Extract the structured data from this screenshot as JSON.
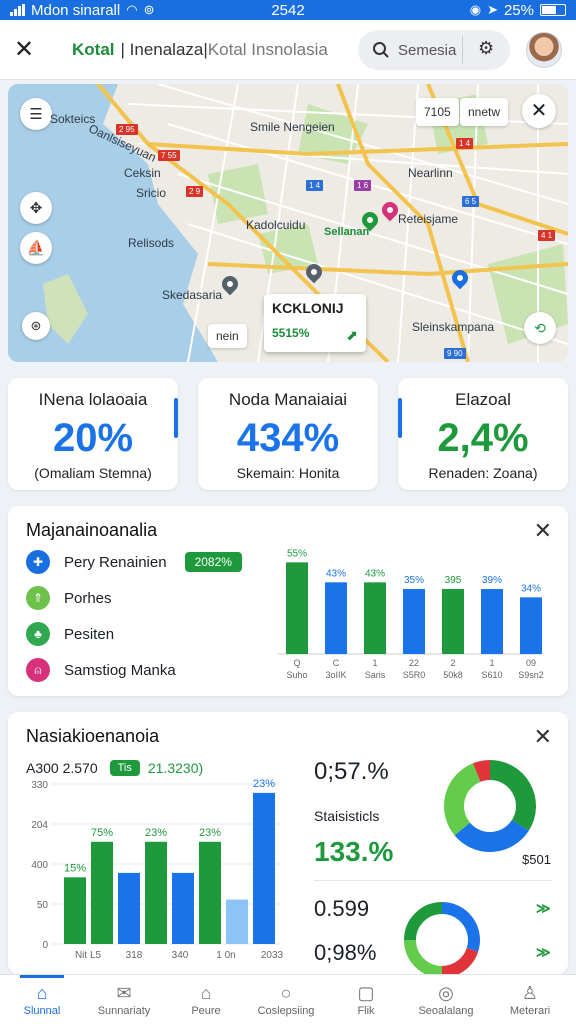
{
  "status": {
    "carrier": "Mdon sinarall",
    "time": "2542",
    "battery": "25%"
  },
  "header": {
    "brand": "Kotal",
    "title_mid": "| Inenalaza|",
    "title_tail": "Kotal Insnolasia",
    "search_label": "Semesia"
  },
  "map": {
    "labels": [
      "Sokteics",
      "Oanlsiseyuan",
      "Ceksin",
      "Sricio",
      "Relisods",
      "Skedasaria",
      "Smile Nengeien",
      "Nearlinn",
      "Reteisjame",
      "Sellanan",
      "Kadolcuidu",
      "Sleinskampana"
    ],
    "chip1": "7105",
    "chip2": "nnetw",
    "popup_title": "KCKLONIJ",
    "popup_value": "5515%",
    "popup_small": "nein"
  },
  "stats": [
    {
      "label": "INena lolaoaia",
      "value": "20%",
      "sub": "(Omaliam Stemna)",
      "color": "#1a73e8"
    },
    {
      "label": "Noda Manaiaiai",
      "value": "434%",
      "sub": "Skemain: Honita",
      "color": "#1a73e8"
    },
    {
      "label": "Elazoal",
      "value": "2,4%",
      "sub": "Renaden: Zoana)",
      "color": "#1e9a3c"
    }
  ],
  "card1": {
    "title": "Majanainoanalia",
    "legend": [
      {
        "label": "Pery Renainien",
        "badge": "2082%",
        "icon_name": "blue-circle-icon",
        "color": "#1a6fe0"
      },
      {
        "label": "Porhes",
        "icon_name": "green-arrows-icon",
        "color": "#6cc24a"
      },
      {
        "label": "Pesiten",
        "icon_name": "green-leaf-icon",
        "color": "#2fa84f"
      },
      {
        "label": "Samstiog Manka",
        "icon_name": "pink-person-icon",
        "color": "#d6317a"
      }
    ]
  },
  "chart_data": [
    {
      "type": "bar",
      "categories": [
        "Suho",
        "3oIIK",
        "Saris",
        "S5R0",
        "50k8",
        "S610",
        "S9sn2"
      ],
      "top_tick_labels": [
        "Q",
        "C",
        "1",
        "22",
        "2",
        "1",
        "09"
      ],
      "series": [
        {
          "values": [
            55,
            null,
            43,
            null,
            39,
            null,
            null
          ]
        },
        {
          "values": [
            null,
            43,
            null,
            39,
            null,
            39,
            34
          ]
        }
      ],
      "data_labels": [
        "55%",
        "43%",
        "43%",
        "35%",
        "395",
        "39%",
        "34%"
      ],
      "colors": [
        "#1e9a3c",
        "#1a73e8",
        "#1e9a3c",
        "#1a73e8",
        "#1e9a3c",
        "#1a73e8",
        "#1a73e8"
      ]
    },
    {
      "type": "bar",
      "categories": [
        "Nit L5",
        "318",
        "340",
        "1 0n",
        "2033"
      ],
      "yticks": [
        "330",
        "204",
        "400",
        "50",
        "0"
      ],
      "header_left": "A300 2.570",
      "header_tag": "Tis",
      "header_right": "21.3230)",
      "data_labels": [
        "15%",
        "75%",
        "23%",
        "23%",
        "23%"
      ],
      "values": [
        15,
        23,
        16,
        23,
        16,
        23,
        10,
        34
      ]
    },
    {
      "type": "pie",
      "values": [
        34,
        30,
        30,
        6
      ],
      "colors": [
        "#1e9a3c",
        "#1a73e8",
        "#64cc4c",
        "#e0343a"
      ]
    },
    {
      "type": "pie",
      "values": [
        30,
        20,
        25,
        25
      ],
      "colors": [
        "#1a73e8",
        "#e0343a",
        "#64cc4c",
        "#1e9a3c"
      ]
    }
  ],
  "card2": {
    "title": "Nasiakioenanoia",
    "stat_top": "0;57.%",
    "stat_label": "Staisisticls",
    "stat_mid": "133.%",
    "donut_value": "$501",
    "stat_bottom1": "0.599",
    "stat_bottom2": "0;98%"
  },
  "nav": [
    {
      "label": "Slunnal",
      "icon": "home-icon",
      "glyph": "⌂"
    },
    {
      "label": "Sunnariaty",
      "icon": "summary-icon",
      "glyph": "✉"
    },
    {
      "label": "Peure",
      "icon": "places-icon",
      "glyph": "⌂"
    },
    {
      "label": "Coslepsiing",
      "icon": "search-icon",
      "glyph": "○"
    },
    {
      "label": "Flik",
      "icon": "file-icon",
      "glyph": "▢"
    },
    {
      "label": "Seoalalang",
      "icon": "globe-icon",
      "glyph": "◎"
    },
    {
      "label": "Meterari",
      "icon": "profile-icon",
      "glyph": "♙"
    }
  ]
}
